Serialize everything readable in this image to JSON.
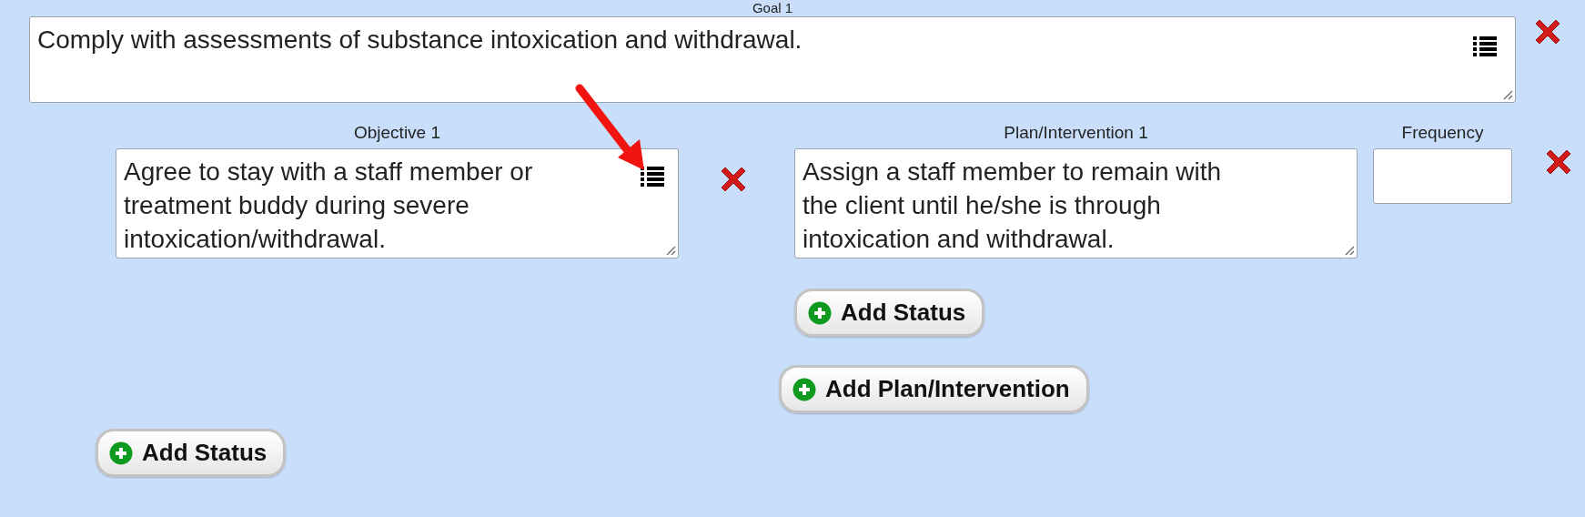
{
  "goal": {
    "label": "Goal 1",
    "text": "Comply with assessments of substance intoxication and withdrawal."
  },
  "objectives": [
    {
      "label": "Objective 1",
      "text": "Agree to stay with a staff member or treatment buddy during severe intoxication/withdrawal.",
      "plans": [
        {
          "label": "Plan/Intervention 1",
          "text": "Assign a staff member to remain with\nthe client until he/she is through\nintoxication and withdrawal.",
          "frequency_label": "Frequency",
          "add_status": "Add Status"
        }
      ],
      "add_plan": "Add Plan/Intervention",
      "add_status": "Add Status"
    }
  ]
}
